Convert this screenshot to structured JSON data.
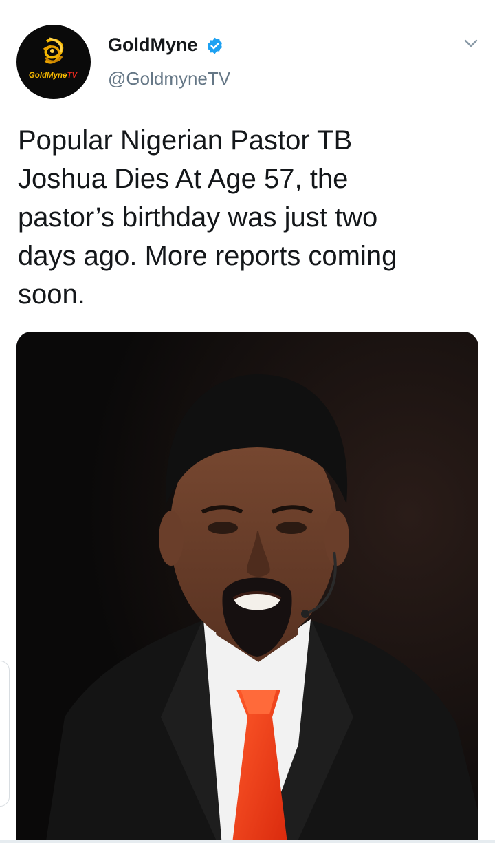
{
  "author": {
    "display_name": "GoldMyne",
    "handle": "@GoldmyneTV",
    "verified": true,
    "avatar_icon": "goldmyne-tv-logo-icon",
    "avatar_text": "GoldMyneTV"
  },
  "tweet": {
    "text": "Popular Nigerian Pastor TB\nJoshua Dies At Age 57,  the\npastor’s birthday was just two\ndays ago.   More reports coming\nsoon."
  },
  "media": {
    "type": "photo",
    "icon": "portrait-photo"
  },
  "menu": {
    "icon": "chevron-down-icon"
  },
  "colors": {
    "verified_blue": "#1da1f2",
    "handle_gray": "#657786",
    "text_dark": "#14171a",
    "brand_gold": "#f5b800",
    "brand_red": "#e0281e"
  }
}
